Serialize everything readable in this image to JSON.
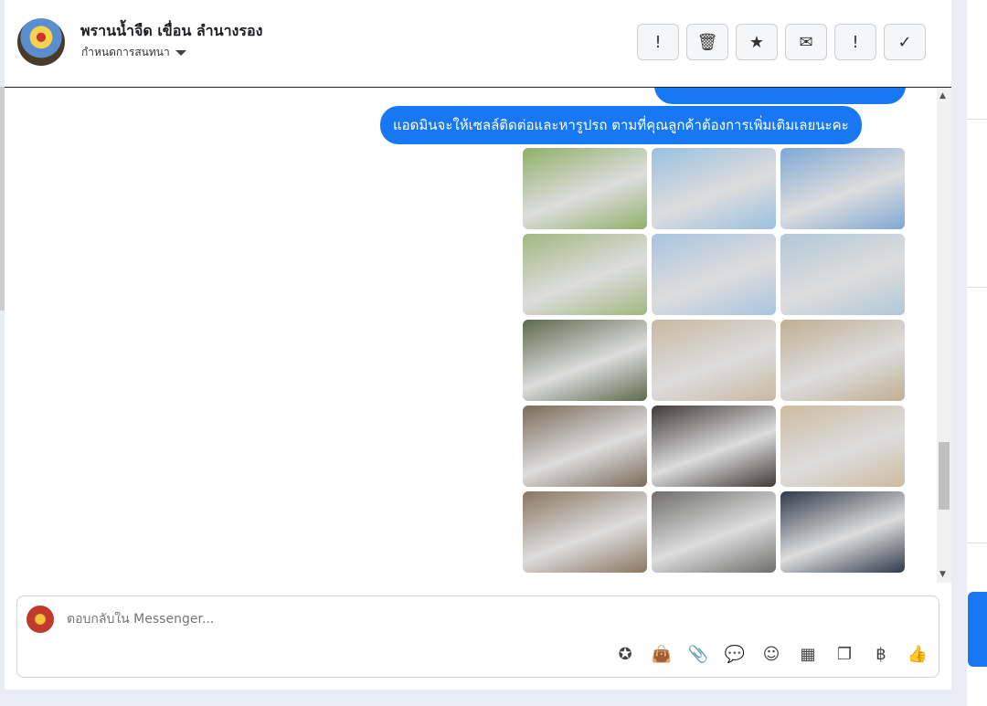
{
  "header": {
    "title": "พรานน้ำจืด เขื่อน ลำนางรอง",
    "subtitle": "กำหนดการสนทนา"
  },
  "actions": [
    {
      "name": "spam-button",
      "icon": "!",
      "label": "spam"
    },
    {
      "name": "delete-button",
      "icon": "🗑",
      "label": "delete"
    },
    {
      "name": "star-button",
      "icon": "★",
      "label": "star"
    },
    {
      "name": "mark-unread-button",
      "icon": "✉",
      "label": "unread"
    },
    {
      "name": "follow-up-button",
      "icon": "!",
      "label": "follow up"
    },
    {
      "name": "done-button",
      "icon": "✓",
      "label": "done"
    }
  ],
  "messages": {
    "bubble": "แอดมินจะให้เซลล์ติดต่อและหารูปรถ ตามที่คุณลูกค้าต้องการเพิ่มเติมเลยนะคะ"
  },
  "photos": [
    "#8fb06a",
    "#9ac0e0",
    "#7fa8d4",
    "#a0b880",
    "#a8c4e0",
    "#b0c8d8",
    "#5b6a4c",
    "#c8b8a0",
    "#c0ae92",
    "#7a6a58",
    "#3e3a38",
    "#cdbba0",
    "#8a7660",
    "#6f6e6c",
    "#2e3a4a"
  ],
  "composer": {
    "placeholder": "ตอบกลับใน Messenger...",
    "tools": [
      {
        "name": "saved-reply-icon",
        "glyph": "✪"
      },
      {
        "name": "shop-bag-icon",
        "glyph": "👜"
      },
      {
        "name": "attachment-icon",
        "glyph": "📎"
      },
      {
        "name": "chat-bubble-icon",
        "glyph": "💬"
      },
      {
        "name": "emoji-icon",
        "glyph": "☺"
      },
      {
        "name": "table-icon",
        "glyph": "▦"
      },
      {
        "name": "documents-icon",
        "glyph": "❐"
      },
      {
        "name": "baht-icon",
        "glyph": "฿"
      },
      {
        "name": "like-icon",
        "glyph": "👍"
      }
    ]
  }
}
